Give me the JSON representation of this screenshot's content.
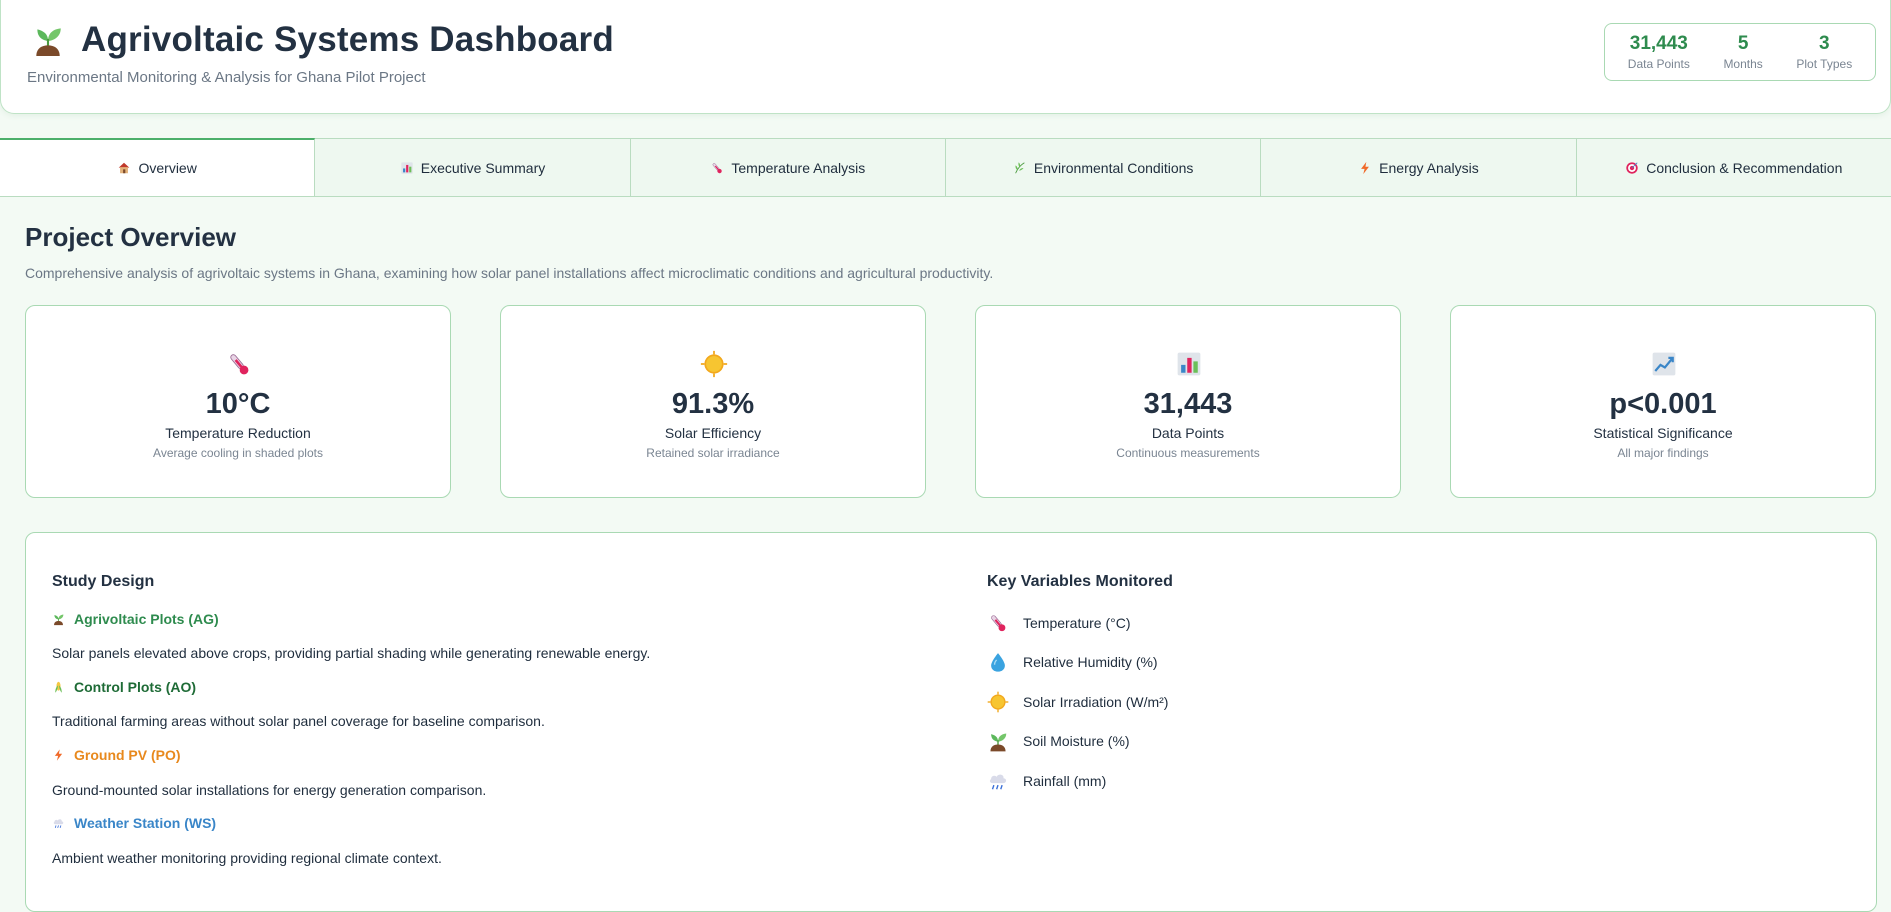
{
  "header": {
    "title": "Agrivoltaic Systems Dashboard",
    "subtitle": "Environmental Monitoring & Analysis for Ghana Pilot Project",
    "icon": "seedling-icon",
    "stats": [
      {
        "value": "31,443",
        "label": "Data Points"
      },
      {
        "value": "5",
        "label": "Months"
      },
      {
        "value": "3",
        "label": "Plot Types"
      }
    ]
  },
  "tabs": [
    {
      "label": "Overview",
      "icon": "house-icon",
      "active": true
    },
    {
      "label": "Executive Summary",
      "icon": "bar-chart-icon",
      "active": false
    },
    {
      "label": "Temperature Analysis",
      "icon": "thermometer-icon",
      "active": false
    },
    {
      "label": "Environmental Conditions",
      "icon": "herb-icon",
      "active": false
    },
    {
      "label": "Energy Analysis",
      "icon": "lightning-icon",
      "active": false
    },
    {
      "label": "Conclusion & Recommendation",
      "icon": "target-icon",
      "active": false
    }
  ],
  "overview": {
    "title": "Project Overview",
    "description": "Comprehensive analysis of agrivoltaic systems in Ghana, examining how solar panel installations affect microclimatic conditions and agricultural productivity."
  },
  "cards": [
    {
      "icon": "thermometer-icon",
      "value": "10°C",
      "label": "Temperature Reduction",
      "sub": "Average cooling in shaded plots"
    },
    {
      "icon": "sun-icon",
      "value": "91.3%",
      "label": "Solar Efficiency",
      "sub": "Retained solar irradiance"
    },
    {
      "icon": "bar-chart-icon",
      "value": "31,443",
      "label": "Data Points",
      "sub": "Continuous measurements"
    },
    {
      "icon": "trend-up-icon",
      "value": "p<0.001",
      "label": "Statistical Significance",
      "sub": "All major findings"
    }
  ],
  "study_design": {
    "title": "Study Design",
    "plots": [
      {
        "icon": "seedling-icon",
        "name": "Agrivoltaic Plots (AG)",
        "color": "#2e8b4e",
        "description": "Solar panels elevated above crops, providing partial shading while generating renewable energy."
      },
      {
        "icon": "corn-icon",
        "name": "Control Plots (AO)",
        "color": "#1e6b36",
        "description": "Traditional farming areas without solar panel coverage for baseline comparison."
      },
      {
        "icon": "lightning-icon",
        "name": "Ground PV (PO)",
        "color": "#e8891d",
        "description": "Ground-mounted solar installations for energy generation comparison."
      },
      {
        "icon": "rain-cloud-icon",
        "name": "Weather Station (WS)",
        "color": "#3a86c8",
        "description": "Ambient weather monitoring providing regional climate context."
      }
    ]
  },
  "variables": {
    "title": "Key Variables Monitored",
    "items": [
      {
        "icon": "thermometer-icon",
        "label": "Temperature (°C)"
      },
      {
        "icon": "droplet-icon",
        "label": "Relative Humidity (%)"
      },
      {
        "icon": "sun-icon",
        "label": "Solar Irradiation (W/m²)"
      },
      {
        "icon": "seedling-icon",
        "label": "Soil Moisture (%)"
      },
      {
        "icon": "rain-cloud-icon",
        "label": "Rainfall (mm)"
      }
    ]
  }
}
